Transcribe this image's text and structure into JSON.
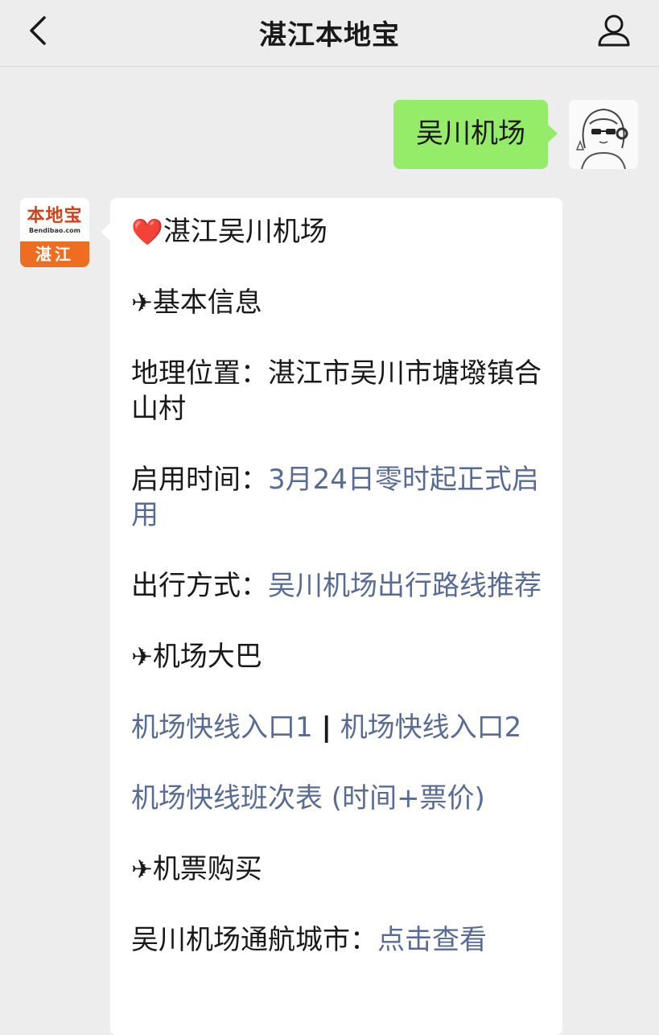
{
  "header": {
    "title": "湛江本地宝",
    "back_icon": "chevron-left-icon",
    "profile_icon": "person-icon"
  },
  "outgoing": {
    "text": "吴川机场"
  },
  "bot": {
    "logo_text": "本地宝",
    "domain_text": "Bendibao.com",
    "city_text": "湛江"
  },
  "message": {
    "heading_icon": "❤️",
    "heading": "湛江吴川机场",
    "plane_icon": "✈",
    "section1": "基本信息",
    "location_label": "地理位置：",
    "location_value": "湛江市吴川市塘墢镇合山村",
    "open_label": "启用时间：",
    "open_link": "3月24日零时起正式启用",
    "travel_label": "出行方式：",
    "travel_link": "吴川机场出行路线推荐",
    "section2": "机场大巴",
    "bus_link1": "机场快线入口1",
    "bus_sep": "|",
    "bus_link2": "机场快线入口2",
    "bus_schedule_link": "机场快线班次表 (时间+票价)",
    "section3": "机票购买",
    "cities_label": "吴川机场通航城市：",
    "cities_link": "点击查看"
  },
  "colors": {
    "background": "#ededed",
    "outgoing_bubble": "#95ec69",
    "link": "#576b95",
    "bot_orange": "#ee6d21"
  }
}
